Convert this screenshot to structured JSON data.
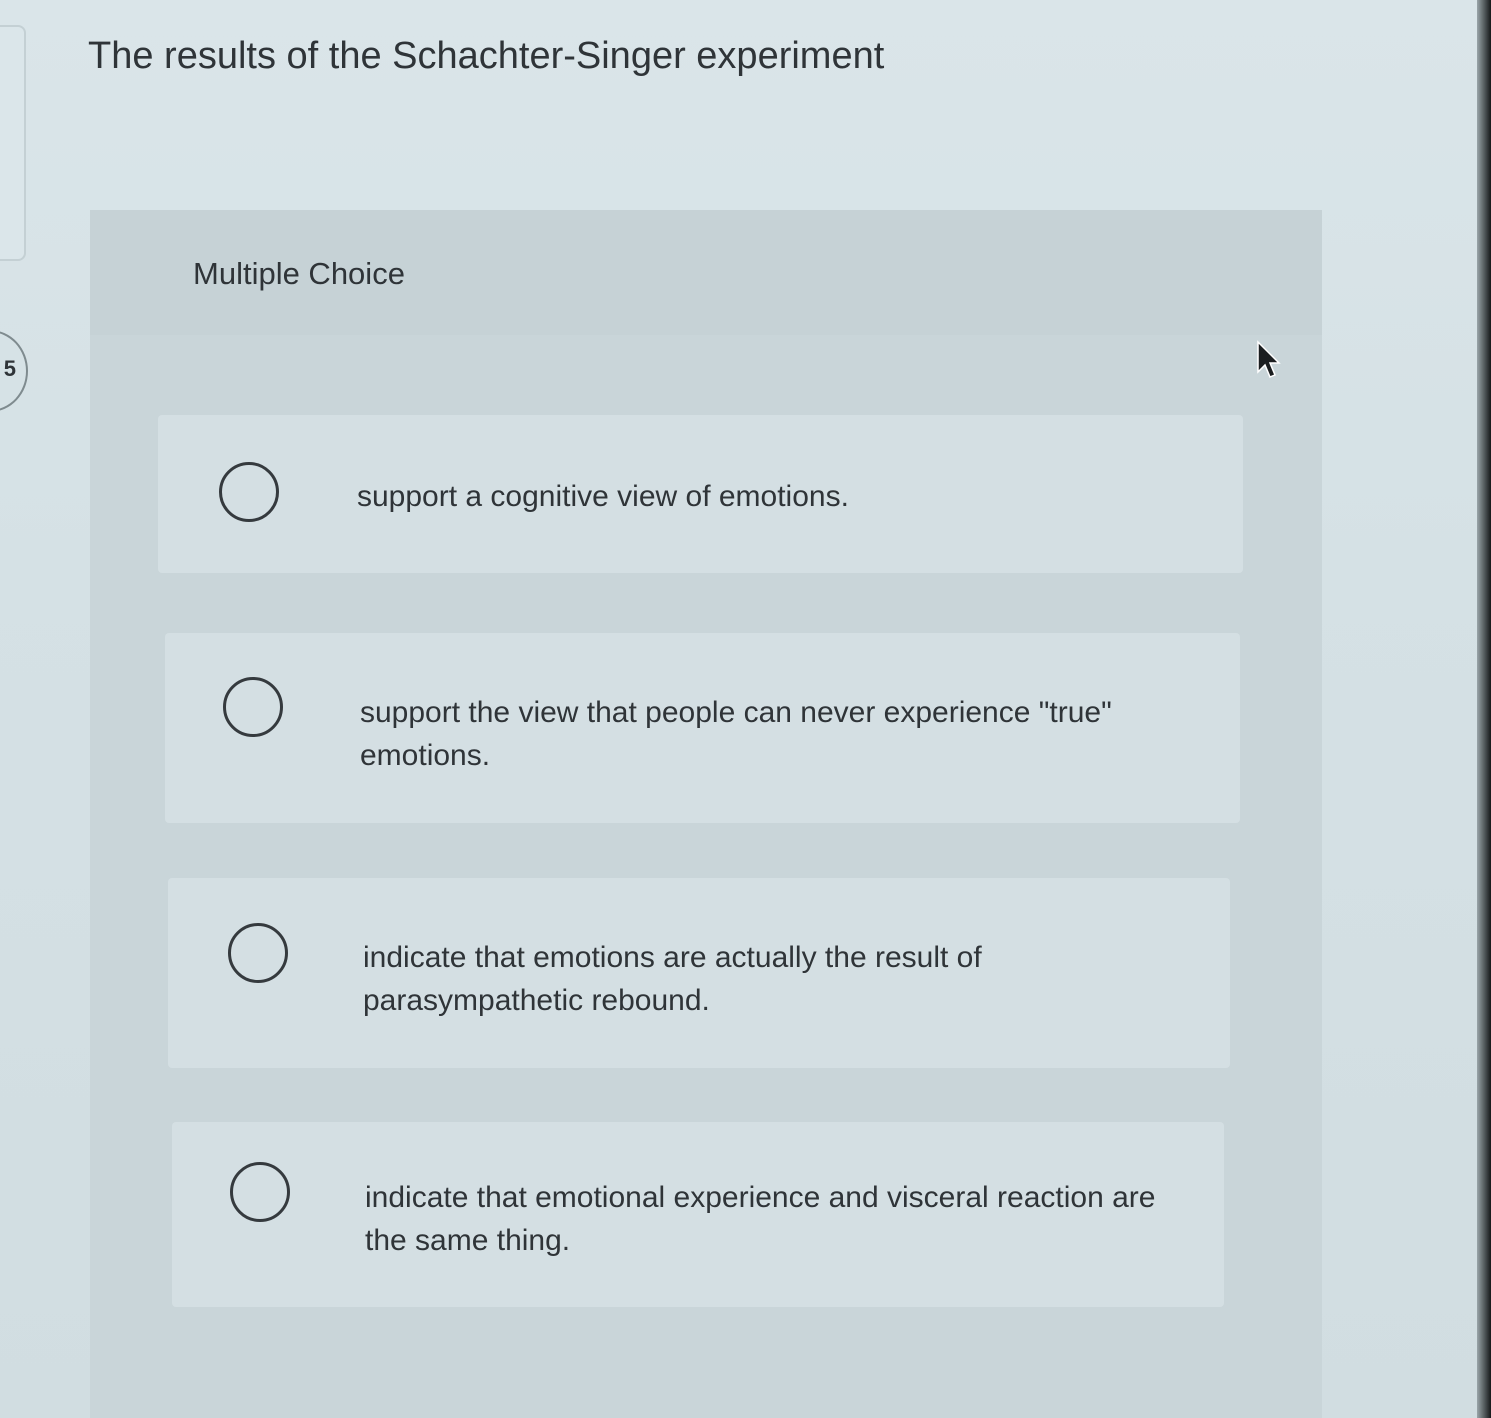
{
  "question": {
    "number": "5",
    "title": "The results of the Schachter-Singer experiment",
    "type_label": "Multiple Choice"
  },
  "options": [
    {
      "text": "support a cognitive view of emotions.",
      "selected": false
    },
    {
      "text": "support the view that people can never experience \"true\" emotions.",
      "selected": false
    },
    {
      "text": "indicate that emotions are actually the result of parasympathetic rebound.",
      "selected": false
    },
    {
      "text": "indicate that emotional experience and visceral reaction are the same thing.",
      "selected": false
    }
  ],
  "icons": {
    "cursor": "mouse-pointer-icon",
    "radio": "radio-circle-icon"
  },
  "colors": {
    "background": "#d6e2e6",
    "panel": "#c9d5d9",
    "option_background": "#d4dfe3",
    "text": "#2f3438"
  }
}
